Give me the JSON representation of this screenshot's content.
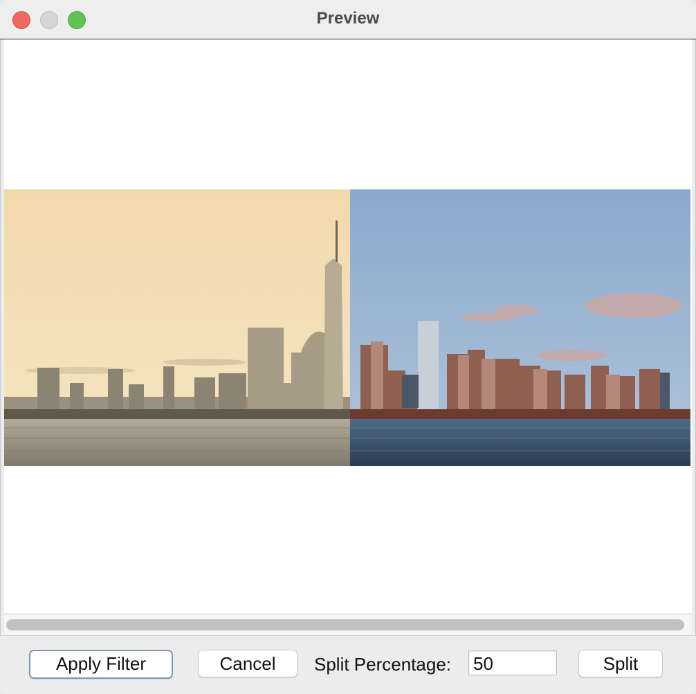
{
  "window": {
    "title": "Preview"
  },
  "image_preview": {
    "left_half_filter": "sepia",
    "right_half_filter": "original"
  },
  "actions": {
    "apply_filter_label": "Apply Filter",
    "cancel_label": "Cancel",
    "split_percentage_label": "Split Percentage:",
    "split_percentage_value": "50",
    "split_label": "Split"
  },
  "colors": {
    "close": "#ee6a5e",
    "minimize": "#d6d6d6",
    "maximize": "#5fc454",
    "default_button_border": "#7f98b8"
  }
}
